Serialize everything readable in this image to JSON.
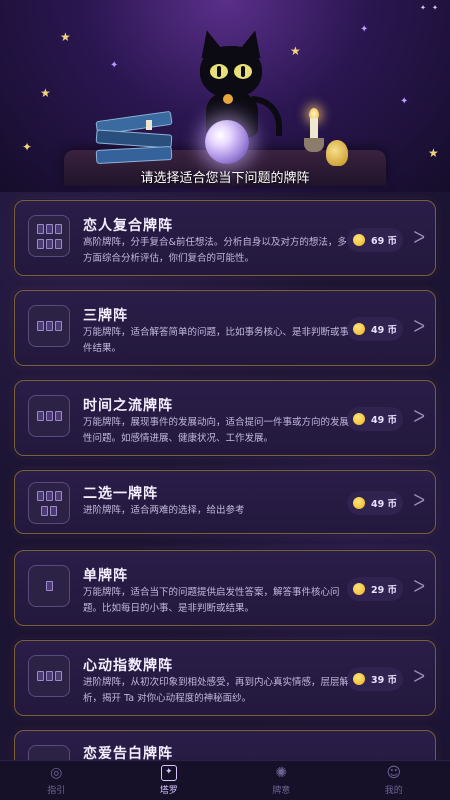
{
  "hero": {
    "caption": "请选择适合您当下问题的牌阵"
  },
  "spreads": [
    {
      "title": "恋人复合牌阵",
      "desc": "高阶牌阵，分手复合&前任想法。分析自身以及对方的想法，多方面综合分析评估，你们复合的可能性。",
      "price": "69 币",
      "icon": "heart-spread-icon"
    },
    {
      "title": "三牌阵",
      "desc": "万能牌阵，适合解答简单的问题，比如事务核心、是非判断或事件结果。",
      "price": "49 币",
      "icon": "three-card-spread-icon"
    },
    {
      "title": "时间之流牌阵",
      "desc": "万能牌阵，展现事件的发展动向，适合提问一件事或方向的发展性问题。如感情进展、健康状况、工作发展。",
      "price": "49 币",
      "icon": "time-flow-spread-icon"
    },
    {
      "title": "二选一牌阵",
      "desc": "进阶牌阵，适合两难的选择，给出参考",
      "price": "49 币",
      "icon": "two-choice-spread-icon"
    },
    {
      "title": "单牌阵",
      "desc": "万能牌阵，适合当下的问题提供启发性答案，解答事件核心问题。比如每日的小事、是非判断或结果。",
      "price": "29 币",
      "icon": "single-card-spread-icon"
    },
    {
      "title": "心动指数牌阵",
      "desc": "进阶牌阵，从初次印象到相处感受，再到内心真实情感，层层解析，揭开 Ta 对你心动程度的神秘面纱。",
      "price": "39 币",
      "icon": "heartbeat-spread-icon"
    },
    {
      "title": "恋爱告白牌阵",
      "desc": "",
      "price": "",
      "icon": "confession-spread-icon"
    }
  ],
  "tabs": [
    {
      "label": "指引",
      "icon": "guide-icon"
    },
    {
      "label": "塔罗",
      "icon": "tarot-icon"
    },
    {
      "label": "牌意",
      "icon": "card-meaning-icon"
    },
    {
      "label": "我的",
      "icon": "profile-icon"
    }
  ],
  "colors": {
    "background": "#1c1433",
    "card_border": "#7a6040",
    "accent": "#d9c6ff",
    "coin": "#f0b21a"
  }
}
